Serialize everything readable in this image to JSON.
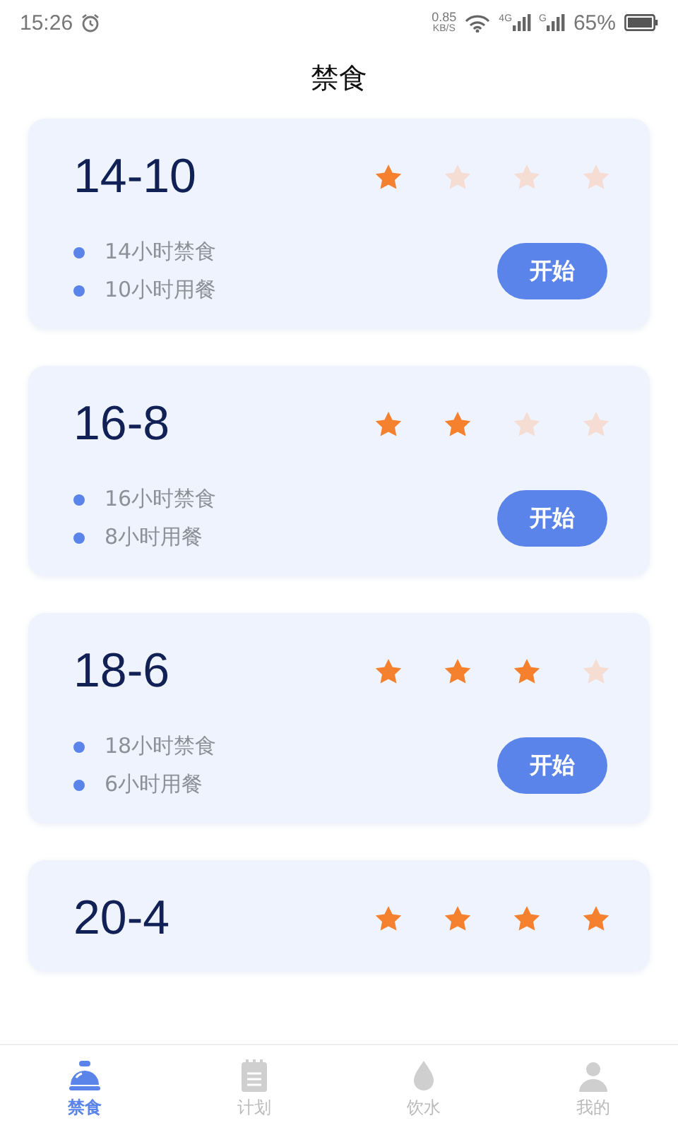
{
  "status_bar": {
    "time": "15:26",
    "speed": "0.85",
    "speed_unit": "KB/S",
    "signal_1": "4G",
    "signal_2": "G",
    "battery": "65%"
  },
  "title": "禁食",
  "plans": [
    {
      "name": "14-10",
      "stars": 1,
      "fast": "14小时禁食",
      "eat": "10小时用餐",
      "button": "开始"
    },
    {
      "name": "16-8",
      "stars": 2,
      "fast": "16小时禁食",
      "eat": "8小时用餐",
      "button": "开始"
    },
    {
      "name": "18-6",
      "stars": 3,
      "fast": "18小时禁食",
      "eat": "6小时用餐",
      "button": "开始"
    },
    {
      "name": "20-4",
      "stars": 4
    }
  ],
  "tabs": [
    {
      "label": "禁食",
      "kind": "dome",
      "selected": true
    },
    {
      "label": "计划",
      "kind": "clipboard",
      "selected": false
    },
    {
      "label": "饮水",
      "kind": "drop",
      "selected": false
    },
    {
      "label": "我的",
      "kind": "person",
      "selected": false
    }
  ]
}
